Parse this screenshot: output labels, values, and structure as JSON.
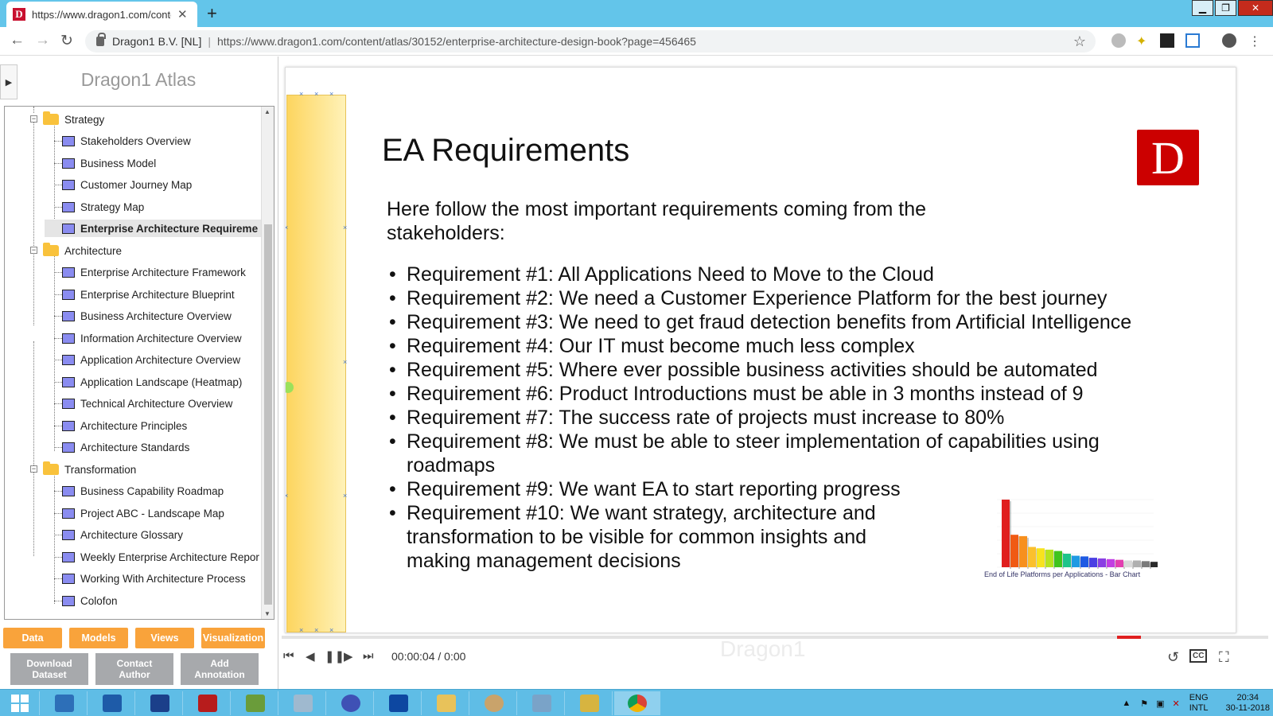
{
  "browser": {
    "tab_title": "https://www.dragon1.com/conte",
    "favicon_letter": "D",
    "site_name": "Dragon1 B.V. [NL]",
    "url": "https://www.dragon1.com/content/atlas/30152/enterprise-architecture-design-book?page=456465"
  },
  "atlas": {
    "title": "Dragon1 Atlas",
    "folders": [
      {
        "label": "Strategy",
        "items": [
          "Stakeholders Overview",
          "Business Model",
          "Customer Journey Map",
          "Strategy Map",
          "Enterprise Architecture Requireme"
        ]
      },
      {
        "label": "Architecture",
        "items": [
          "Enterprise Architecture Framework",
          "Enterprise Architecture Blueprint",
          "Business Architecture Overview",
          "Information Architecture Overview",
          "Application Architecture Overview",
          "Application Landscape (Heatmap)",
          "Technical Architecture Overview",
          "Architecture Principles",
          "Architecture Standards"
        ]
      },
      {
        "label": "Transformation",
        "items": [
          "Business Capability Roadmap",
          "Project ABC - Landscape Map",
          "Architecture Glossary",
          "Weekly Enterprise Architecture Repor",
          "Working With Architecture Process",
          "Colofon"
        ]
      }
    ],
    "selected_item": "Enterprise Architecture Requireme",
    "orange_buttons": [
      "Data",
      "Models",
      "Views",
      "Visualization"
    ],
    "grey_buttons": [
      {
        "line1": "Download",
        "line2": "Dataset"
      },
      {
        "line1": "Contact",
        "line2": "Author"
      },
      {
        "line1": "Add",
        "line2": "Annotation"
      }
    ]
  },
  "slide": {
    "title": "EA Requirements",
    "logo_letter": "D",
    "intro": "Here follow the most important requirements coming from the stakeholders:",
    "requirements": [
      "Requirement #1: All Applications Need to Move to the Cloud",
      "Requirement #2: We need a Customer Experience Platform for the best journey",
      "Requirement #3: We need to get fraud detection benefits from Artificial Intelligence",
      "Requirement #4: Our IT must become much less complex",
      "Requirement #5: Where ever possible business activities should be automated",
      "Requirement #6: Product Introductions must be able in 3 months instead of 9",
      "Requirement #7: The success rate of projects must increase to 80%",
      "Requirement #8: We must be able to steer implementation of capabilities using roadmaps",
      "Requirement #9: We want EA to start reporting progress",
      "Requirement #10: We want strategy, architecture and transformation to be visible for common insights and making management decisions"
    ],
    "thumbnail_caption": "End of Life Platforms per Applications - Bar Chart",
    "thumbnail_bar_colors": [
      "#e01e1e",
      "#f05a14",
      "#f7901e",
      "#fbc02d",
      "#f7e31e",
      "#b6e31e",
      "#3fc41e",
      "#1ec48a",
      "#1e9ae3",
      "#1e5ae3",
      "#4a3fe3",
      "#8a3fe3",
      "#c23fe3",
      "#e33fb0",
      "#d9d9d9",
      "#b0b0b0",
      "#7a7a7a",
      "#2a2a2a"
    ],
    "thumbnail_bar_values": [
      1.0,
      0.48,
      0.46,
      0.3,
      0.28,
      0.26,
      0.24,
      0.2,
      0.17,
      0.16,
      0.14,
      0.13,
      0.12,
      0.11,
      0.1,
      0.1,
      0.09,
      0.08
    ]
  },
  "player": {
    "time": "00:00:04 / 0:00",
    "watermark": "Dragon1",
    "progress_fraction": 0.0
  },
  "taskbar": {
    "lang_top": "ENG",
    "lang_bottom": "INTL",
    "clock_time": "20:34",
    "clock_date": "30-11-2018"
  }
}
